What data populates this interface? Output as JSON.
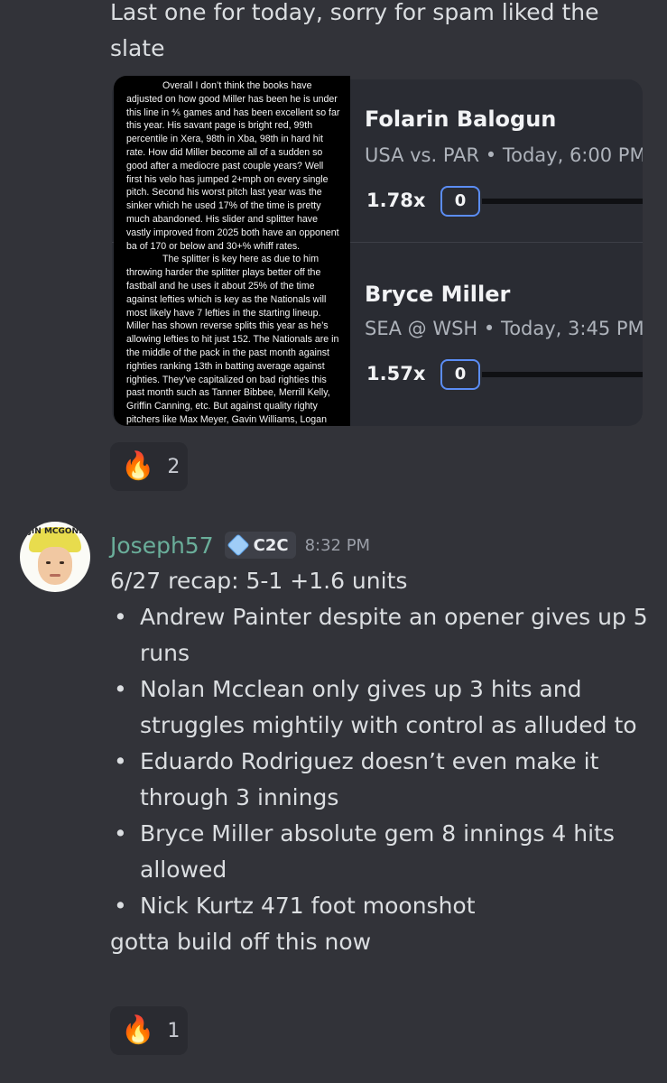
{
  "previous_message": {
    "text": "Last one for today, sorry for spam liked the slate",
    "embed": {
      "note_paragraphs": [
        "Overall I don’t think the books have adjusted on how good Miller has been he is under this line in ⅘ games and has been excellent so far this year. His savant page is bright red, 99th percentile in Xera, 98th in Xba, 98th in hard hit rate. How did Miller become all of a sudden so good after a mediocre past couple years? Well first his velo has jumped 2+mph on every single pitch. Second his worst pitch last year was the sinker which he used 17% of the time is pretty much abandoned. His slider and splitter have vastly improved from 2025 both have an opponent ba of 170 or below and 30+% whiff rates.",
        "The splitter is key here as due to him throwing harder the splitter plays better off the fastball and he uses it about 25% of the time against lefties which is key as the Nationals will most likely have 7 lefties in the starting lineup. Miller has shown reverse splits this year as he’s allowing lefties to hit just 152. The Nationals are in the middle of the pack in the past month against righties ranking 13th in batting average against righties. They’ve capitalized on bad righties this past month  such as Tanner Bibbee, Merrill Kelly, Griffin Canning, etc. But against quality righty pitchers like Max Meyer, Gavin Williams, Logan"
      ],
      "picks": [
        {
          "name": "Folarin Balogun",
          "game": "USA vs. PAR • Today, 6:00 PM",
          "multiplier": "1.78x",
          "value": "0"
        },
        {
          "name": "Bryce Miller",
          "game": "SEA @ WSH • Today, 3:45 PM",
          "multiplier": "1.57x",
          "value": "0"
        }
      ]
    },
    "reaction": {
      "emoji": "🔥",
      "count": "2"
    }
  },
  "message": {
    "avatar_cap_text": "JIN MCGONI",
    "username": "Joseph57",
    "tag": "C2C",
    "time": "8:32 PM",
    "intro": "6/27 recap: 5-1 +1.6 units",
    "bullets": [
      "Andrew Painter despite an opener gives up 5 runs",
      "Nolan Mcclean only gives up 3 hits and struggles mightily with control as alluded to",
      "Eduardo Rodriguez doesn’t even make it through 3 innings",
      "Bryce Miller absolute gem 8 innings 4 hits allowed",
      "Nick Kurtz 471 foot moonshot"
    ],
    "outro": "gotta build off this now",
    "reaction": {
      "emoji": "🔥",
      "count": "1"
    }
  },
  "colors": {
    "background": "#323339",
    "username": "#6aae9a",
    "accent_box": "#5b8df5"
  }
}
